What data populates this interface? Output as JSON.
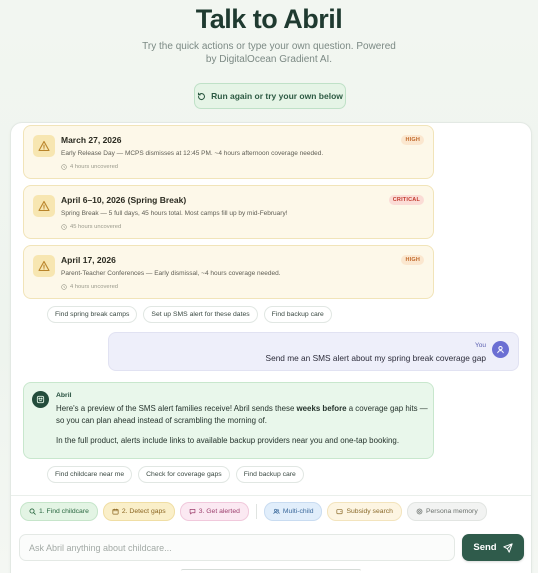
{
  "hero": {
    "title": "Talk to Abril",
    "subtitle": "Try the quick actions or type your own question. Powered by DigitalOcean Gradient AI.",
    "run_again_label": "Run again or try your own below"
  },
  "gap_cards": [
    {
      "date": "March 27, 2026",
      "description": "Early Release Day — MCPS dismisses at 12:45 PM. ~4 hours afternoon coverage needed.",
      "uncovered": "4 hours uncovered",
      "severity": "HIGH"
    },
    {
      "date": "April 6–10, 2026 (Spring Break)",
      "description": "Spring Break — 5 full days, 45 hours total. Most camps fill up by mid-February!",
      "uncovered": "45 hours uncovered",
      "severity": "CRITICAL"
    },
    {
      "date": "April 17, 2026",
      "description": "Parent-Teacher Conferences — Early dismissal, ~4 hours coverage needed.",
      "uncovered": "4 hours uncovered",
      "severity": "HIGH"
    }
  ],
  "suggestions_1": [
    "Find spring break camps",
    "Set up SMS alert for these dates",
    "Find backup care"
  ],
  "user_message": {
    "sender": "You",
    "text": "Send me an SMS alert about my spring break coverage gap"
  },
  "assistant_message": {
    "sender": "Abril",
    "line1_pre": "Here's a preview of the SMS alert families receive! Abril sends these ",
    "line1_bold": "weeks before",
    "line1_post": " a coverage gap hits — so you can plan ahead instead of scrambling the morning of.",
    "line2": "In the full product, alerts include links to available backup providers near you and one-tap booking."
  },
  "suggestions_2": [
    "Find childcare near me",
    "Check for coverage gaps",
    "Find backup care"
  ],
  "quick_actions": {
    "find": "1. Find childcare",
    "detect": "2. Detect gaps",
    "alert": "3. Get alerted",
    "multi": "Multi-child",
    "subsidy": "Subsidy search",
    "persona": "Persona memory"
  },
  "composer": {
    "placeholder": "Ask Abril anything about childcare...",
    "send_label": "Send"
  },
  "colors": {
    "brand": "#2f5b4b",
    "high": "#c0682a",
    "critical": "#c23a2e"
  }
}
